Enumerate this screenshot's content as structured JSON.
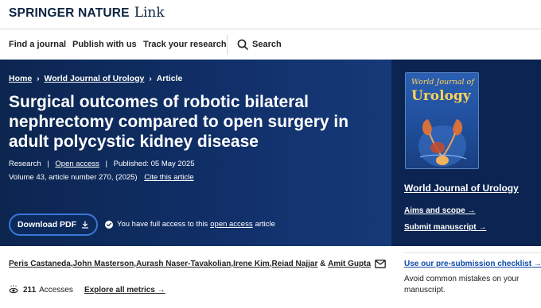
{
  "header": {
    "brand": "SPRINGER NATURE",
    "brand_suffix": "Link"
  },
  "nav": {
    "find_journal": "Find a journal",
    "publish": "Publish with us",
    "track": "Track your research",
    "search": "Search"
  },
  "breadcrumb": {
    "home": "Home",
    "journal": "World Journal of Urology",
    "current": "Article"
  },
  "article": {
    "title": "Surgical outcomes of robotic bilateral nephrectomy compared to open surgery in adult polycystic kidney disease",
    "type": "Research",
    "access": "Open access",
    "published": "Published: 05 May 2025",
    "volume": "Volume 43, article number 270, (2025)",
    "cite": "Cite this article",
    "download": "Download PDF",
    "access_note_prefix": "You have full access to this",
    "access_note_link": "open access",
    "access_note_suffix": "article",
    "authors": [
      "Peris Castaneda",
      "John Masterson",
      "Aurash Naser-Tavakolian",
      "Irene Kim",
      "Reiad Najjar",
      "Amit Gupta"
    ],
    "author_sep": ", ",
    "author_and": " & ",
    "accesses_count": "211",
    "accesses_label": "Accesses",
    "explore_metrics": "Explore all metrics"
  },
  "cover": {
    "line1": "World Journal of",
    "line2": "Urology"
  },
  "sidebar": {
    "journal_name": "World Journal of Urology",
    "aims": "Aims and scope",
    "submit": "Submit manuscript",
    "checklist": "Use our pre-submission checklist",
    "checklist_desc": "Avoid common mistakes on your manuscript."
  },
  "colors": {
    "hero_bg": "#0c2650",
    "accent_link": "#0e4aa8",
    "button_border": "#3a77d6",
    "cover_text": "#ffd35a"
  }
}
